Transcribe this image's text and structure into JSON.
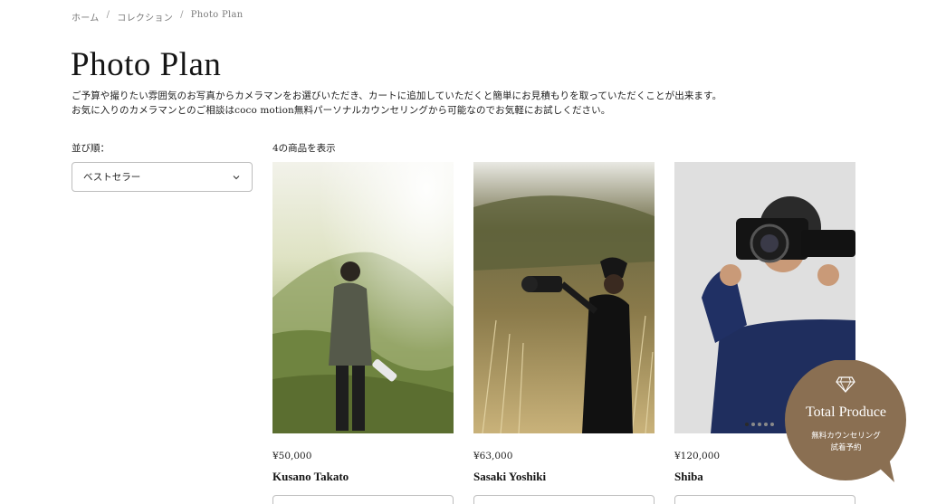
{
  "breadcrumb": {
    "home": "ホーム",
    "collection": "コレクション",
    "current": "Photo Plan",
    "separator": "/"
  },
  "page": {
    "title": "Photo Plan",
    "description": [
      "ご予算や撮りたい雰囲気のお写真からカメラマンをお選びいただき、カートに追加していただくと簡単にお見積もりを取っていただくことが出来ます。",
      "お気に入りのカメラマンとのご相談はcoco motion無料パーソナルカウンセリングから可能なのでお気軽にお試しください。"
    ]
  },
  "sort": {
    "label": "並び順：",
    "selected": "ベストセラー"
  },
  "results": {
    "count_text": "4の商品を表示"
  },
  "products": [
    {
      "price": "¥50,000",
      "name": "Kusano Takato"
    },
    {
      "price": "¥63,000",
      "name": "Sasaki Yoshiki"
    },
    {
      "price": "¥120,000",
      "name": "Shiba"
    }
  ],
  "carousel": {
    "active_index": 0,
    "count": 5
  },
  "counseling_bubble": {
    "title": "Total Produce",
    "line1": "無料カウンセリング",
    "line2": "試着予約",
    "icon": "diamond-icon"
  },
  "colors": {
    "bubble": "#8a6f52",
    "border": "#bdbdbd"
  }
}
